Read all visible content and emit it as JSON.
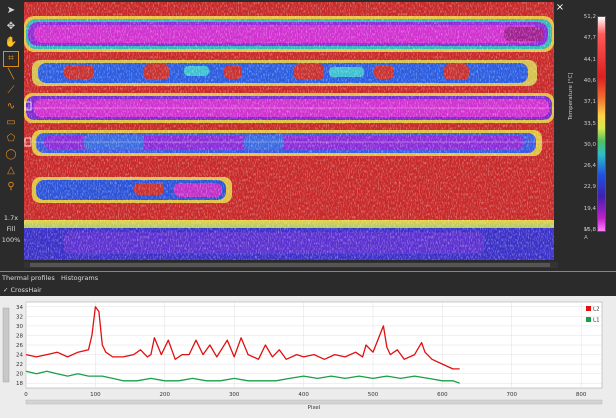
{
  "toolbar": {
    "tools": [
      "cursor-icon",
      "move-icon",
      "hand-icon",
      "crop-icon",
      "line-icon",
      "polyline-icon",
      "wave-icon",
      "rectangle-icon",
      "polygon-icon",
      "ellipse-icon",
      "triangle-icon",
      "magnify-icon"
    ],
    "zoom_value": "1.7x",
    "fill_label": "Fill",
    "percent_label": "100%"
  },
  "thermal_image": {
    "close_glyph": "×",
    "scale_ticks": [
      "51,2",
      "47,7",
      "44,1",
      "40,6",
      "37,1",
      "33,5",
      "30,0",
      "26,4",
      "22,9",
      "19,4",
      "15,8"
    ],
    "scale_axis_label": "Temperature [°C]",
    "scale_controls": [
      "M",
      "A"
    ]
  },
  "panel": {
    "tabs": [
      "Thermal profiles",
      "Histograms"
    ],
    "crosshair_label": "CrossHair"
  },
  "chart_data": {
    "type": "line",
    "xlabel": "Pixel",
    "ylabel": "Temperature [°C]",
    "xlim": [
      0,
      830
    ],
    "ylim": [
      17,
      35
    ],
    "xticks": [
      0,
      100,
      200,
      300,
      400,
      500,
      600,
      700,
      800
    ],
    "yticks": [
      18,
      20,
      22,
      24,
      26,
      28,
      30,
      32,
      34
    ],
    "legend_position": "top-right",
    "series": [
      {
        "name": "L2",
        "color": "#e01010",
        "x": [
          0,
          15,
          30,
          45,
          60,
          75,
          90,
          95,
          100,
          105,
          110,
          115,
          125,
          140,
          155,
          165,
          175,
          180,
          185,
          195,
          205,
          215,
          225,
          235,
          245,
          255,
          265,
          275,
          290,
          300,
          310,
          320,
          335,
          345,
          355,
          365,
          375,
          390,
          400,
          415,
          430,
          445,
          460,
          475,
          485,
          490,
          500,
          515,
          520,
          525,
          535,
          545,
          560,
          570,
          575,
          585,
          600,
          615,
          625
        ],
        "y": [
          24,
          23.5,
          24,
          24.5,
          23.5,
          24.5,
          25,
          28,
          34,
          33,
          26,
          24.5,
          23.5,
          23.5,
          24,
          25,
          23.5,
          24,
          27.5,
          24,
          27,
          23,
          24,
          24,
          27,
          24,
          26,
          23.5,
          27,
          23.5,
          27.5,
          24,
          23,
          26,
          23.5,
          25,
          23,
          24,
          23.5,
          24,
          23,
          24,
          23.5,
          24.5,
          23.5,
          26,
          24.5,
          30,
          25.5,
          24,
          25,
          23,
          24,
          26.5,
          24.5,
          23,
          22,
          21,
          21
        ]
      },
      {
        "name": "L1",
        "color": "#18a048",
        "x": [
          0,
          15,
          30,
          45,
          60,
          75,
          90,
          110,
          125,
          140,
          160,
          180,
          200,
          220,
          240,
          260,
          280,
          300,
          320,
          340,
          360,
          380,
          400,
          420,
          440,
          460,
          480,
          500,
          520,
          540,
          560,
          580,
          600,
          615,
          625
        ],
        "y": [
          20.5,
          20,
          20.5,
          20,
          19.5,
          20,
          19.5,
          19.5,
          19,
          18.5,
          18.5,
          19,
          18.5,
          18.5,
          19,
          18.5,
          18.5,
          19,
          18.5,
          18.5,
          18.5,
          19,
          19.5,
          19,
          19.5,
          19,
          19.5,
          19,
          19.5,
          19,
          19.5,
          19,
          18.5,
          18.5,
          18
        ]
      }
    ]
  }
}
